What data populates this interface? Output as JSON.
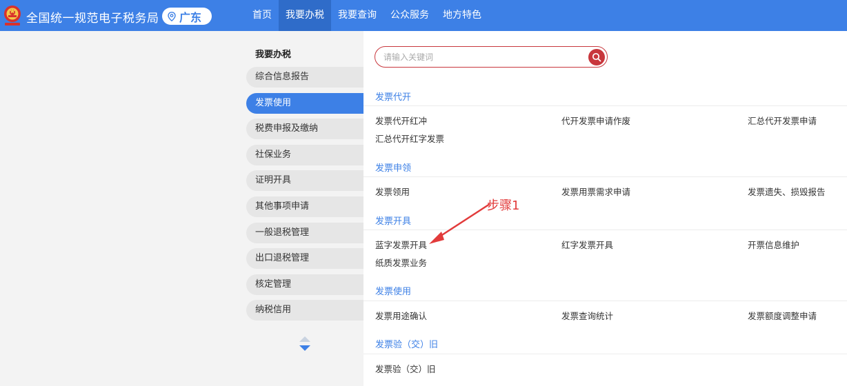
{
  "header": {
    "logo_icon": "tax-emblem-icon",
    "title": "全国统一规范电子税务局",
    "region": "广东",
    "nav": [
      {
        "label": "首页",
        "active": false
      },
      {
        "label": "我要办税",
        "active": true
      },
      {
        "label": "我要查询",
        "active": false
      },
      {
        "label": "公众服务",
        "active": false
      },
      {
        "label": "地方特色",
        "active": false
      }
    ]
  },
  "sidebar": {
    "title": "我要办税",
    "items": [
      {
        "label": "综合信息报告",
        "active": false
      },
      {
        "label": "发票使用",
        "active": true
      },
      {
        "label": "税费申报及缴纳",
        "active": false
      },
      {
        "label": "社保业务",
        "active": false
      },
      {
        "label": "证明开具",
        "active": false
      },
      {
        "label": "其他事项申请",
        "active": false
      },
      {
        "label": "一般退税管理",
        "active": false
      },
      {
        "label": "出口退税管理",
        "active": false
      },
      {
        "label": "核定管理",
        "active": false
      },
      {
        "label": "纳税信用",
        "active": false
      }
    ]
  },
  "search": {
    "placeholder": "请输入关键词",
    "icon": "search-icon"
  },
  "sections": [
    {
      "title": "发票代开",
      "links": [
        "发票代开红冲",
        "代开发票申请作废",
        "汇总代开发票申请",
        "汇总代开红字发票"
      ]
    },
    {
      "title": "发票申领",
      "links": [
        "发票领用",
        "发票用票需求申请",
        "发票遗失、损毁报告"
      ]
    },
    {
      "title": "发票开具",
      "links": [
        "蓝字发票开具",
        "红字发票开具",
        "开票信息维护",
        "纸质发票业务"
      ]
    },
    {
      "title": "发票使用",
      "links": [
        "发票用途确认",
        "发票查询统计",
        "发票额度调整申请"
      ]
    },
    {
      "title": "发票验（交）旧",
      "links": [
        "发票验（交）旧"
      ]
    }
  ],
  "annotation": {
    "text": "步骤1",
    "color": "#e23b3b"
  },
  "colors": {
    "brand_blue": "#3d80e6",
    "nav_active": "#2f6cc9",
    "accent_red": "#c8363c"
  }
}
